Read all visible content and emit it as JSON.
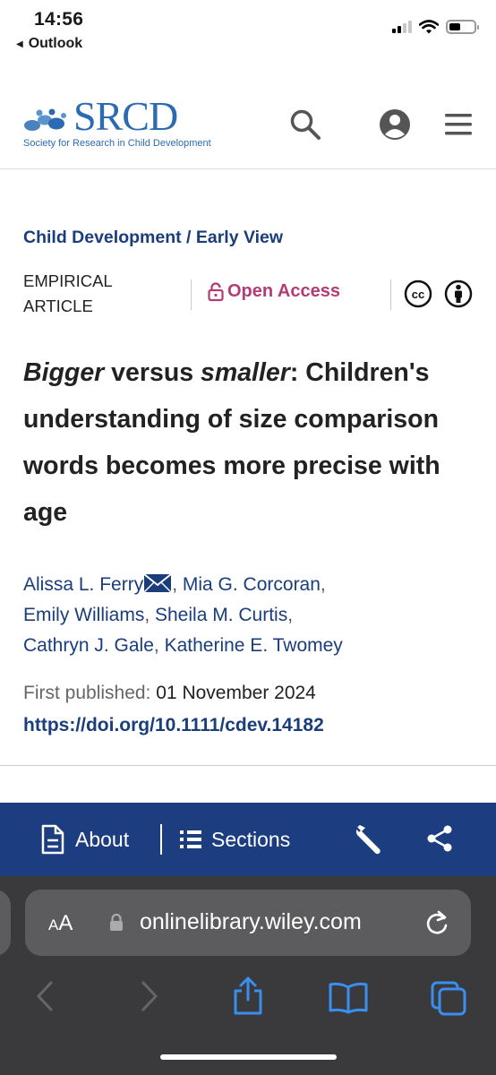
{
  "status_bar": {
    "time": "14:56",
    "back_label": "Outlook"
  },
  "header": {
    "logo_text": "SRCD",
    "logo_subtitle": "Society for Research in Child Development",
    "brand_color": "#2a6bb3"
  },
  "article": {
    "breadcrumb": "Child Development / Early View",
    "type_line1": "EMPIRICAL",
    "type_line2": "ARTICLE",
    "open_access": "Open Access",
    "title_part1": "Bigger",
    "title_part2": " versus ",
    "title_part3": "smaller",
    "title_part4": ": Children's understanding of size comparison words becomes more precise with age",
    "authors": [
      "Alissa L. Ferry",
      "Mia G. Corcoran",
      "Emily Williams",
      "Sheila M. Curtis",
      "Cathryn J. Gale",
      "Katherine E. Twomey"
    ],
    "first_published_label": "First published:",
    "first_published_date": "01 November 2024",
    "doi": "https://doi.org/10.1111/cdev.14182",
    "link_color": "#1a3d7c",
    "oa_color": "#b53b77"
  },
  "toolbar": {
    "about_label": "About",
    "sections_label": "Sections",
    "bg_color": "#1c3d80"
  },
  "browser": {
    "aa_small": "A",
    "aa_large": "A",
    "url": "onlinelibrary.wiley.com"
  },
  "icons": {
    "search": "search-icon",
    "account": "account-icon",
    "menu": "menu-icon",
    "lock": "lock-icon",
    "cc": "creative-commons-icon",
    "by": "attribution-icon",
    "mail": "mail-icon",
    "document": "document-icon",
    "list": "list-icon",
    "wrench": "wrench-icon",
    "share": "share-icon",
    "reload": "reload-icon"
  }
}
